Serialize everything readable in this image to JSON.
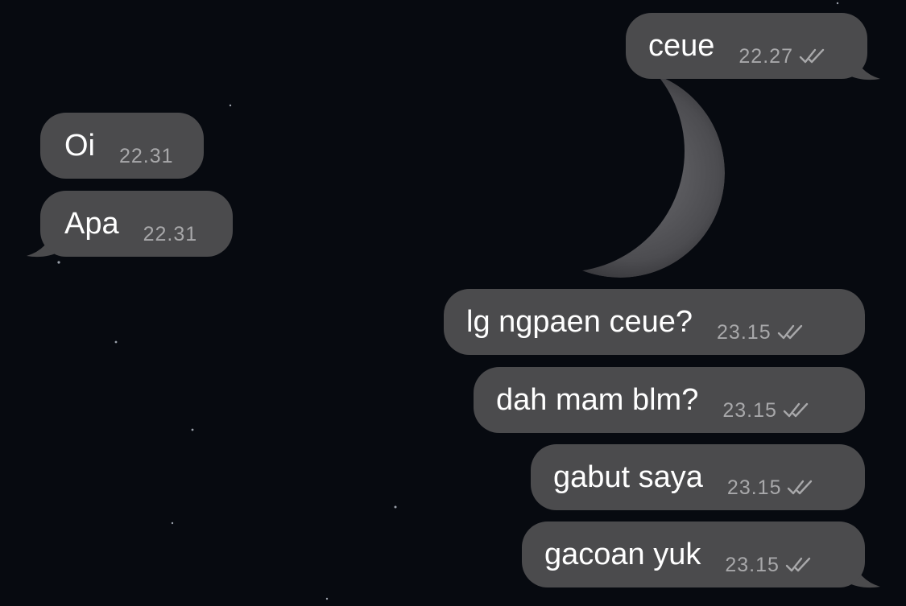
{
  "messages": [
    {
      "dir": "out",
      "text": "ceue",
      "time": "22.27",
      "status": "read-double-check-icon"
    },
    {
      "dir": "in",
      "text": "Oi",
      "time": "22.31"
    },
    {
      "dir": "in",
      "text": "Apa",
      "time": "22.31"
    },
    {
      "dir": "out",
      "text": "lg ngpaen ceue?",
      "time": "23.15",
      "status": "read-double-check-icon"
    },
    {
      "dir": "out",
      "text": "dah mam blm?",
      "time": "23.15",
      "status": "read-double-check-icon"
    },
    {
      "dir": "out",
      "text": "gabut saya",
      "time": "23.15",
      "status": "read-double-check-icon"
    },
    {
      "dir": "out",
      "text": "gacoan yuk",
      "time": "23.15",
      "status": "read-double-check-icon"
    }
  ],
  "colors": {
    "background": "#070a10",
    "bubble": "#4b4b4d",
    "message_text": "#ffffff",
    "timestamp": "#a8a8aa"
  }
}
